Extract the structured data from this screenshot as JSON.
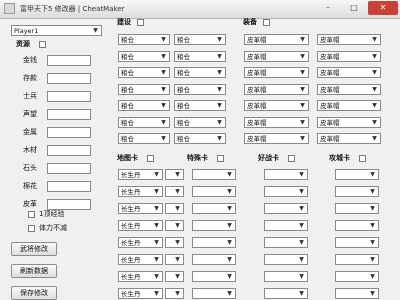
{
  "window": {
    "title": "富甲天下5 修改器 | CheatMaker",
    "minimize_symbol": "–",
    "maximize_symbol": "□",
    "close_symbol": "✕"
  },
  "player_select": {
    "value": "Player1"
  },
  "resources": {
    "label": "资源",
    "fields": [
      {
        "label": "金钱",
        "value": ""
      },
      {
        "label": "存款",
        "value": ""
      },
      {
        "label": "士兵",
        "value": ""
      },
      {
        "label": "声望",
        "value": ""
      },
      {
        "label": "金属",
        "value": ""
      },
      {
        "label": "木材",
        "value": ""
      },
      {
        "label": "石头",
        "value": ""
      },
      {
        "label": "棉花",
        "value": ""
      },
      {
        "label": "皮革",
        "value": ""
      }
    ]
  },
  "options": {
    "one_hit_exp": "1顶经验",
    "stamina_unlimited": "体力不减"
  },
  "buttons": {
    "apply_button": "武将修改",
    "refresh_button": "刷新数据",
    "save_button": "保存修改"
  },
  "buildings": {
    "label": "建设",
    "value": "粮仓",
    "rows": 7
  },
  "equipment": {
    "label": "装备",
    "value": "皮革帽",
    "rows": 7
  },
  "cards": {
    "rows": 8,
    "groups": [
      {
        "label": "地图卡",
        "value": "长生丹"
      },
      {
        "label": "特殊卡",
        "value": ""
      },
      {
        "label": "好战卡",
        "value": ""
      },
      {
        "label": "攻城卡",
        "value": ""
      }
    ]
  },
  "dropdown_arrow": "▼"
}
